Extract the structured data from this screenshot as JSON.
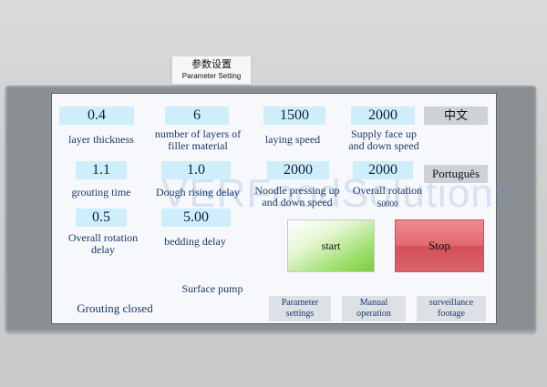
{
  "plate": {
    "zh": "参数设置",
    "en": "Parameter Setting"
  },
  "watermark": "VERFoodSolutions",
  "params": {
    "layer_thickness": {
      "value": "0.4",
      "label": "layer thickness"
    },
    "filler_layers": {
      "value": "6",
      "label_l1": "number of layers of",
      "label_l2": "filler material"
    },
    "laying_speed": {
      "value": "1500",
      "label": "laying speed"
    },
    "supply_face": {
      "value": "2000",
      "label_l1": "Supply face up",
      "label_l2": "and down speed"
    },
    "grouting_time": {
      "value": "1.1",
      "label": "grouting time"
    },
    "dough_rising": {
      "value": "1.0",
      "label": "Dough rising delay"
    },
    "noodle_pressing": {
      "value": "2000",
      "label_l1": "Noodle pressing up",
      "label_l2": "and down speed"
    },
    "overall_rotation": {
      "value": "2000",
      "label": "Overall rotation",
      "sub": "S0000"
    },
    "overall_rotation_delay": {
      "value": "0.5",
      "label_l1": "Overall rotation",
      "label_l2": "delay"
    },
    "bedding_delay": {
      "value": "5.00",
      "label": "bedding delay"
    }
  },
  "lang": {
    "chinese": "中文",
    "portuguese": "Português"
  },
  "buttons": {
    "start": "start",
    "stop": "Stop"
  },
  "status": {
    "surface_pump": "Surface pump",
    "grouting": "Grouting closed"
  },
  "nav": {
    "param_l1": "Parameter",
    "param_l2": "settings",
    "manual_l1": "Manual",
    "manual_l2": "operation",
    "surv_l1": "surveillance",
    "surv_l2": "footage"
  }
}
